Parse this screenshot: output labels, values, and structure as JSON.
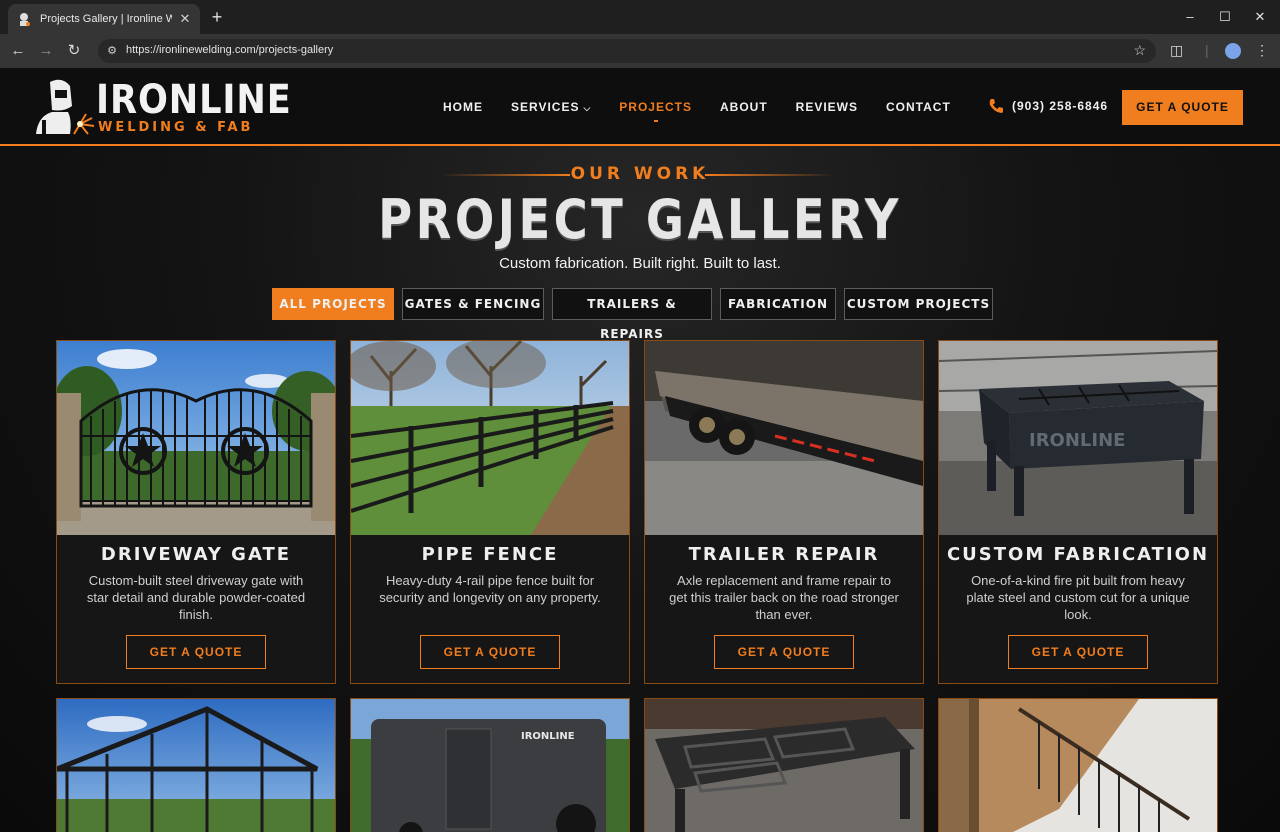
{
  "browser": {
    "tab_title": "Projects Gallery | Ironline Welding",
    "url": "https://ironlinewelding.com/projects-gallery",
    "new_tab": "+",
    "close": "✕"
  },
  "site": {
    "logo": {
      "name": "IRONLINE",
      "tagline": "WELDING & FAB"
    },
    "nav": [
      {
        "label": "HOME"
      },
      {
        "label": "SERVICES"
      },
      {
        "label": "PROJECTS"
      },
      {
        "label": "ABOUT"
      },
      {
        "label": "REVIEWS"
      },
      {
        "label": "CONTACT"
      }
    ],
    "active_nav": "PROJECTS",
    "phone": "(903) 258-6846",
    "cta": "GET A QUOTE",
    "accent_color": "#f07d1e"
  },
  "hero": {
    "eyebrow": "OUR WORK",
    "title": "PROJECT GALLERY",
    "subtitle": "Custom fabrication. Built right. Built to last."
  },
  "filters": [
    {
      "label": "ALL PROJECTS",
      "active": true
    },
    {
      "label": "GATES & FENCING",
      "active": false
    },
    {
      "label": "TRAILERS & REPAIRS",
      "active": false
    },
    {
      "label": "FABRICATION",
      "active": false
    },
    {
      "label": "CUSTOM PROJECTS",
      "active": false
    }
  ],
  "projects": [
    {
      "title": "DRIVEWAY GATE",
      "description": "Custom-built steel driveway gate with star detail and durable powder-coated finish.",
      "button": "GET A QUOTE"
    },
    {
      "title": "PIPE FENCE",
      "description": "Heavy-duty 4-rail pipe fence built for security and longevity on any property.",
      "button": "GET A QUOTE"
    },
    {
      "title": "TRAILER REPAIR",
      "description": "Axle replacement and frame repair to get this trailer back on the road stronger than ever.",
      "button": "GET A QUOTE"
    },
    {
      "title": "CUSTOM FABRICATION",
      "description": "One-of-a-kind fire pit built from heavy plate steel and custom cut for a unique look.",
      "button": "GET A QUOTE"
    }
  ],
  "images": {
    "fire_pit_lettering": "IRONLINE",
    "trailer_decal": "IRONLINE"
  }
}
